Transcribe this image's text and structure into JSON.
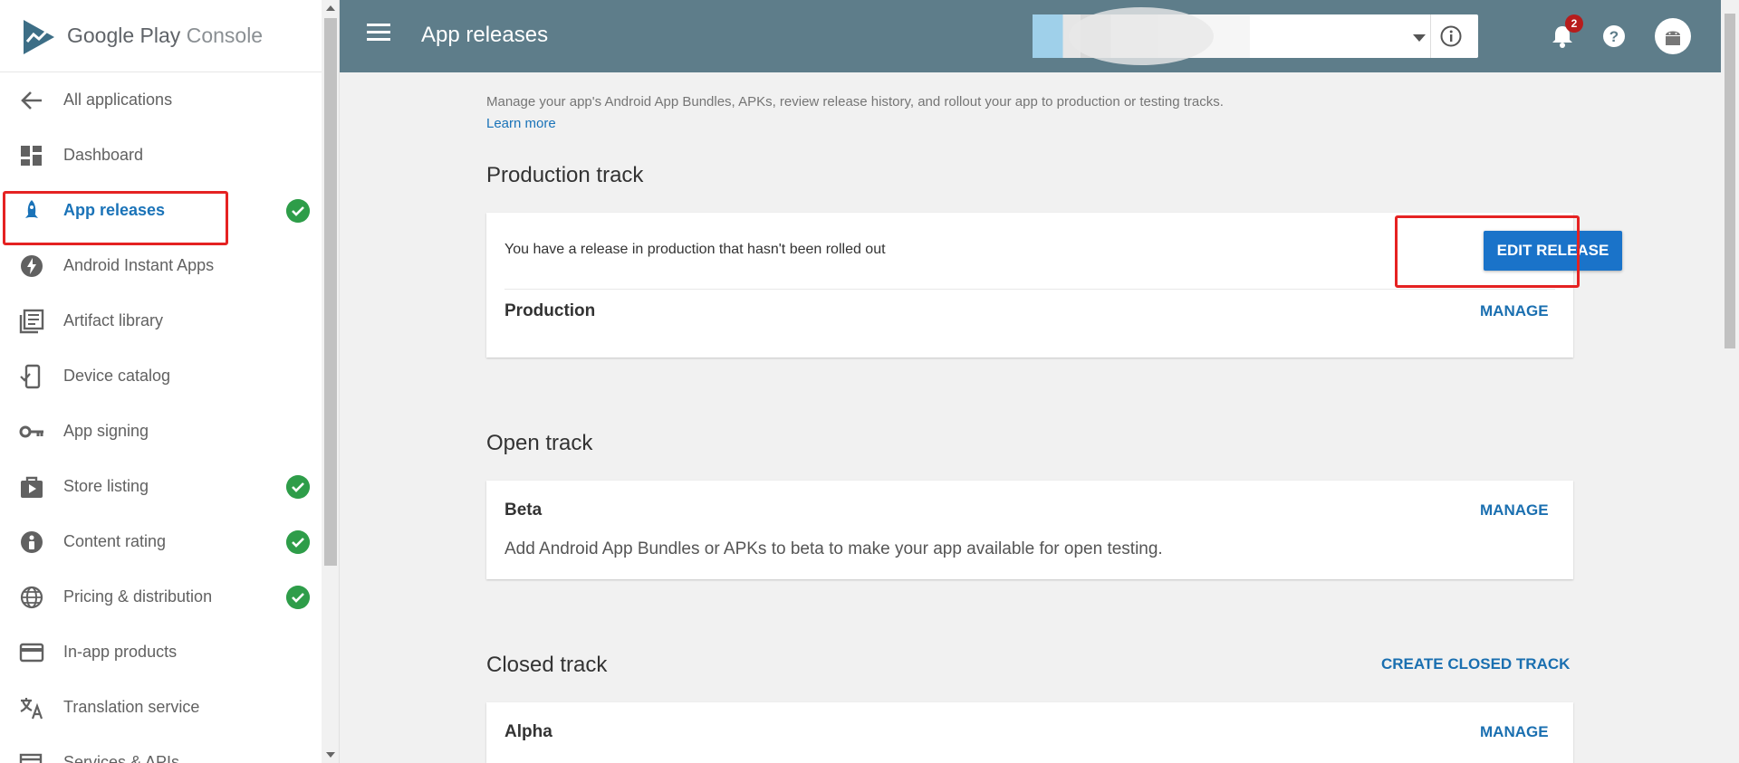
{
  "brand": {
    "name": "Google Play",
    "suffix": "Console"
  },
  "sidebar": {
    "items": [
      {
        "label": "All applications",
        "icon": "arrow-back-icon"
      },
      {
        "label": "Dashboard",
        "icon": "dashboard-icon"
      },
      {
        "label": "App releases",
        "icon": "rocket-icon",
        "active": true,
        "complete": true
      },
      {
        "label": "Android Instant Apps",
        "icon": "bolt-icon"
      },
      {
        "label": "Artifact library",
        "icon": "library-icon"
      },
      {
        "label": "Device catalog",
        "icon": "device-icon"
      },
      {
        "label": "App signing",
        "icon": "key-icon"
      },
      {
        "label": "Store listing",
        "icon": "store-icon",
        "complete": true
      },
      {
        "label": "Content rating",
        "icon": "rating-icon",
        "complete": true
      },
      {
        "label": "Pricing & distribution",
        "icon": "globe-icon",
        "complete": true
      },
      {
        "label": "In-app products",
        "icon": "card-icon"
      },
      {
        "label": "Translation service",
        "icon": "translate-icon"
      },
      {
        "label": "Services & APIs",
        "icon": "services-icon"
      }
    ]
  },
  "topbar": {
    "title": "App releases",
    "notification_count": "2"
  },
  "main": {
    "intro": "Manage your app's Android App Bundles, APKs, review release history, and rollout your app to production or testing tracks.",
    "learn_more": "Learn more",
    "production": {
      "title": "Production track",
      "notice": "You have a release in production that hasn't been rolled out",
      "edit_label": "EDIT RELEASE",
      "track_name": "Production",
      "manage_label": "MANAGE"
    },
    "open": {
      "title": "Open track",
      "track_name": "Beta",
      "manage_label": "MANAGE",
      "description": "Add Android App Bundles or APKs to beta to make your app available for open testing."
    },
    "closed": {
      "title": "Closed track",
      "create_label": "CREATE CLOSED TRACK",
      "track_name": "Alpha",
      "manage_label": "MANAGE"
    }
  },
  "colors": {
    "accent": "#1a73c9",
    "topbar": "#5e7d8a",
    "success": "#2e9d49",
    "highlight": "#e52222"
  }
}
